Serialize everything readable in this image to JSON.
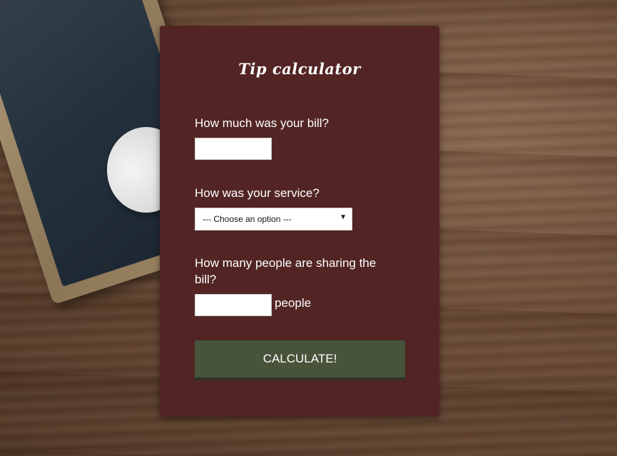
{
  "form": {
    "title": "Tip calculator",
    "bill_question": "How much was your bill?",
    "bill_value": "",
    "service_question": "How was your service?",
    "service_selected": "--- Choose an option ---",
    "people_question": "How many people are sharing the bill?",
    "people_value": "",
    "people_suffix": "people",
    "calculate_label": "CALCULATE!"
  },
  "colors": {
    "card_background": "#522524",
    "button_background": "#47533a",
    "text": "#ffffff"
  },
  "icons": {
    "select_arrow": "chevron-down-icon"
  }
}
